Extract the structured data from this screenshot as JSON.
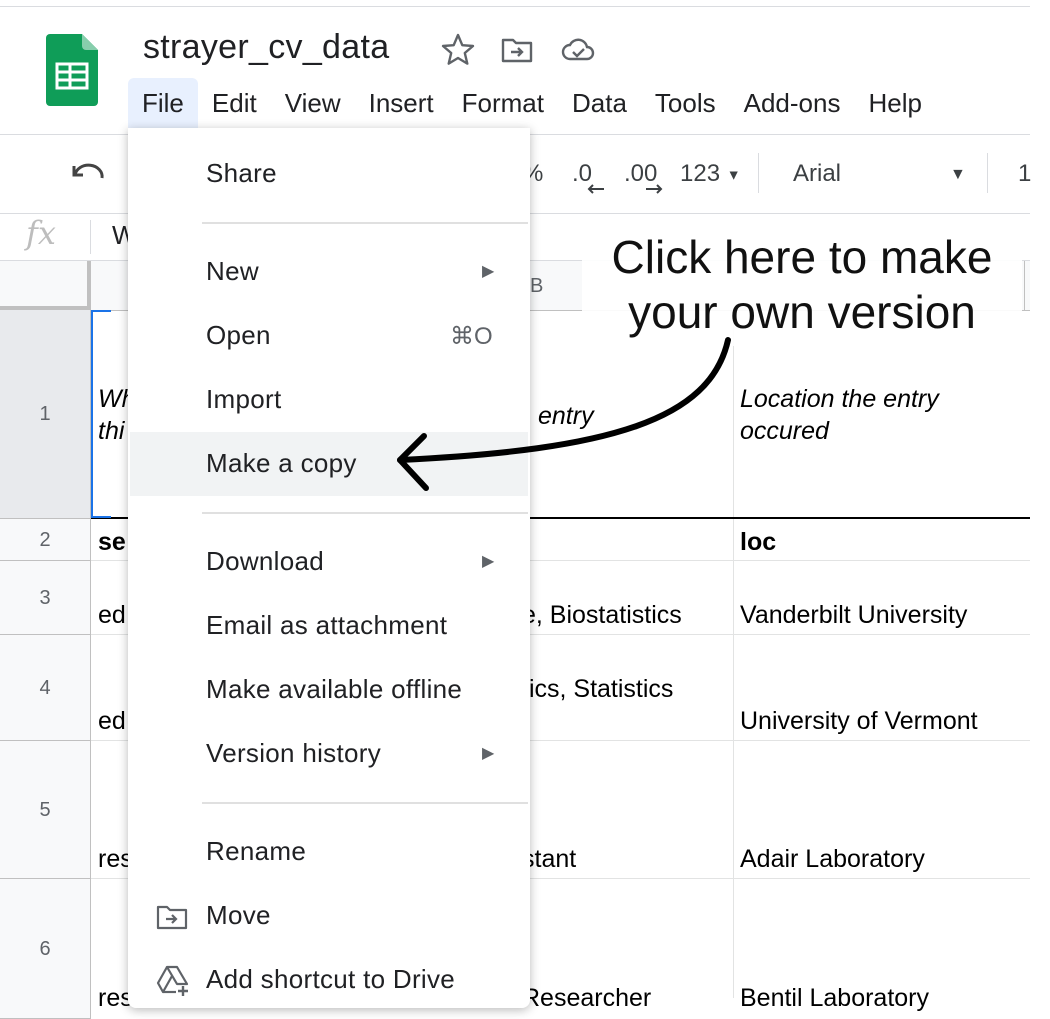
{
  "doc": {
    "title": "strayer_cv_data"
  },
  "menubar": [
    "File",
    "Edit",
    "View",
    "Insert",
    "Format",
    "Data",
    "Tools",
    "Add-ons",
    "Help"
  ],
  "toolbar": {
    "percent": "%",
    "dec_less": ".0",
    "dec_more": ".00",
    "num_format": "123",
    "font": "Arial",
    "size_partial": "1"
  },
  "formula_bar": {
    "fx": "fx",
    "content": "W"
  },
  "grid": {
    "column_b": "B",
    "rows": [
      "1",
      "2",
      "3",
      "4",
      "5",
      "6"
    ],
    "cells": {
      "a1_l1": "Wh",
      "a1_l2": "thi",
      "b1": "entry",
      "c1_l1": "Location the entry",
      "c1_l2": "occured",
      "a2": "se",
      "c2": "loc",
      "a3": "ed",
      "b3": "e, Biostatistics",
      "c3": "Vanderbilt University",
      "b4": "tics, Statistics",
      "a4": "ed",
      "c4": "University of Vermont",
      "a5": "res",
      "b5": "stant",
      "c5": "Adair Laboratory",
      "a6": "res",
      "b6": "Researcher",
      "c6": "Bentil Laboratory"
    }
  },
  "file_menu": {
    "share": "Share",
    "new": "New",
    "open": "Open",
    "open_shortcut": "⌘O",
    "import": "Import",
    "make_copy": "Make a copy",
    "download": "Download",
    "email": "Email as attachment",
    "offline": "Make available offline",
    "version_history": "Version history",
    "rename": "Rename",
    "move": "Move",
    "add_shortcut": "Add shortcut to Drive"
  },
  "annotation": {
    "line1": "Click here to make",
    "line2": "your own version"
  },
  "colors": {
    "sheets_green": "#0f9d58",
    "selection_blue": "#1a73e8",
    "menu_highlight": "#f1f3f4"
  }
}
